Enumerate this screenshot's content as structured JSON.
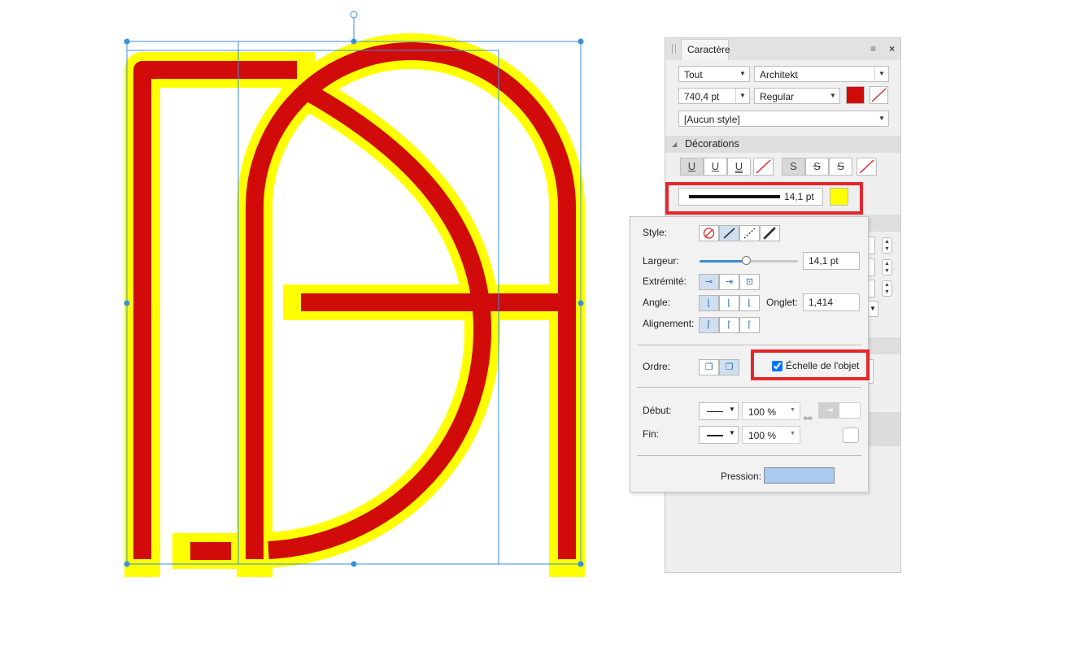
{
  "panel": {
    "tab_title": "Caractère",
    "menu_icon": "≡",
    "close_icon": "×",
    "scope_value": "Tout",
    "font_family": "Architekt",
    "font_size": "740,4 pt",
    "font_style": "Regular",
    "text_color": "#d10a0a",
    "paragraph_style": "[Aucun style]",
    "section_decorations": "Décorations",
    "deco_buttons": [
      "U",
      "U",
      "U",
      "S",
      "S",
      "S"
    ],
    "stroke_width": "14,1 pt",
    "stroke_color": "#ffff00"
  },
  "popup": {
    "style_label": "Style:",
    "width_label": "Largeur:",
    "width_value": "14,1 pt",
    "width_slider_fraction": 0.47,
    "cap_label": "Extrémité:",
    "angle_label": "Angle:",
    "miter_label": "Onglet:",
    "miter_value": "1,414",
    "align_label": "Alignement:",
    "order_label": "Ordre:",
    "scale_label": "Échelle de l'objet",
    "scale_checked": true,
    "start_label": "Début:",
    "start_percent": "100 %",
    "end_label": "Fin:",
    "end_percent": "100 %",
    "pressure_label": "Pression:"
  },
  "colors": {
    "glyph_fill": "#d10a0a",
    "glyph_outline": "#ffff00",
    "selection": "#3a8fd8",
    "highlight": "#e5262a"
  }
}
